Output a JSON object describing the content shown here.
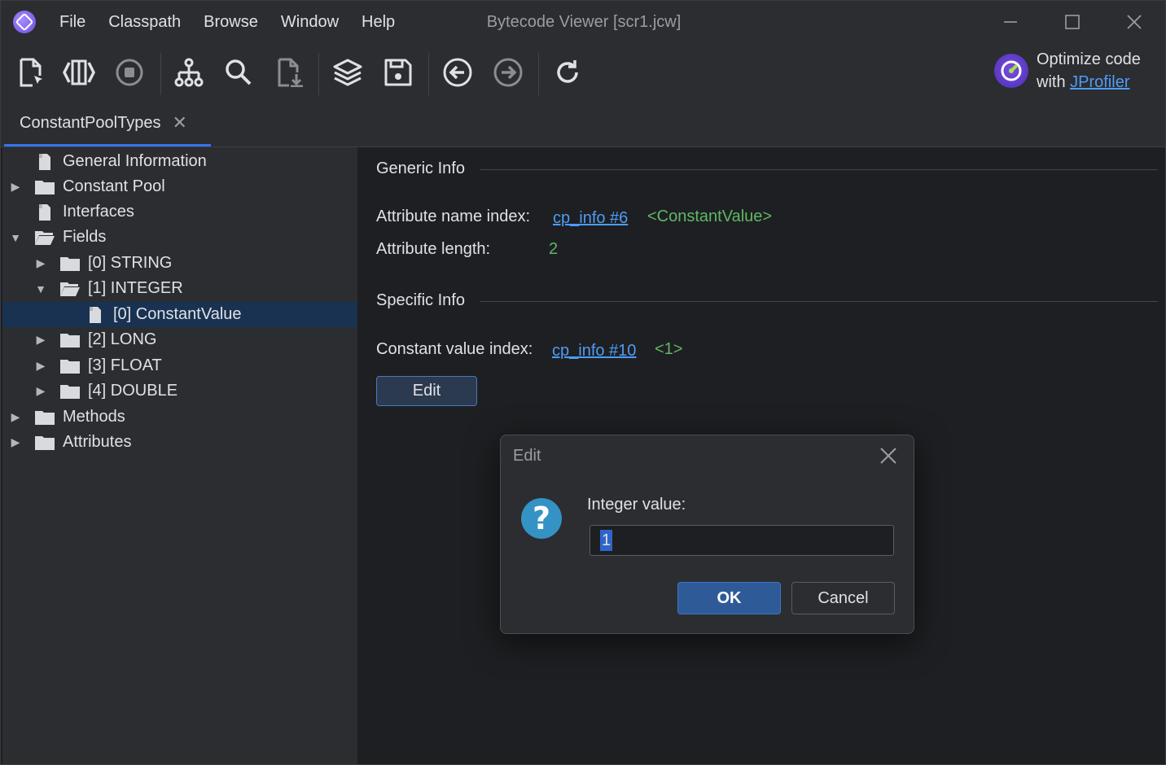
{
  "titlebar": {
    "menu": [
      "File",
      "Classpath",
      "Browse",
      "Window",
      "Help"
    ],
    "title": "Bytecode Viewer [scr1.jcw]"
  },
  "toolbar": {
    "icons": [
      "open-file-icon",
      "compile-icon",
      "stop-icon",
      "hierarchy-icon",
      "search-icon",
      "export-icon",
      "layers-icon",
      "save-icon",
      "back-icon",
      "forward-icon",
      "refresh-icon"
    ],
    "promo_line1": "Optimize code",
    "promo_prefix": "with ",
    "promo_link": "JProfiler"
  },
  "tabs": [
    {
      "label": "ConstantPoolTypes",
      "close": "✕"
    }
  ],
  "tree": {
    "items": [
      {
        "label": "General Information"
      },
      {
        "label": "Constant Pool"
      },
      {
        "label": "Interfaces"
      },
      {
        "label": "Fields"
      },
      {
        "label": "[0] STRING"
      },
      {
        "label": "[1] INTEGER"
      },
      {
        "label": "[0] ConstantValue"
      },
      {
        "label": "[2] LONG"
      },
      {
        "label": "[3] FLOAT"
      },
      {
        "label": "[4] DOUBLE"
      },
      {
        "label": "Methods"
      },
      {
        "label": "Attributes"
      }
    ]
  },
  "detail": {
    "generic_title": "Generic Info",
    "attr_name_label": "Attribute name index:",
    "attr_name_link": "cp_info #6",
    "attr_name_value": "<ConstantValue>",
    "attr_len_label": "Attribute length:",
    "attr_len_value": "2",
    "specific_title": "Specific Info",
    "const_label": "Constant value index:",
    "const_link": "cp_info #10",
    "const_value": "<1>",
    "edit_button": "Edit"
  },
  "dialog": {
    "title": "Edit",
    "label": "Integer value:",
    "value": "1",
    "ok": "OK",
    "cancel": "Cancel"
  }
}
